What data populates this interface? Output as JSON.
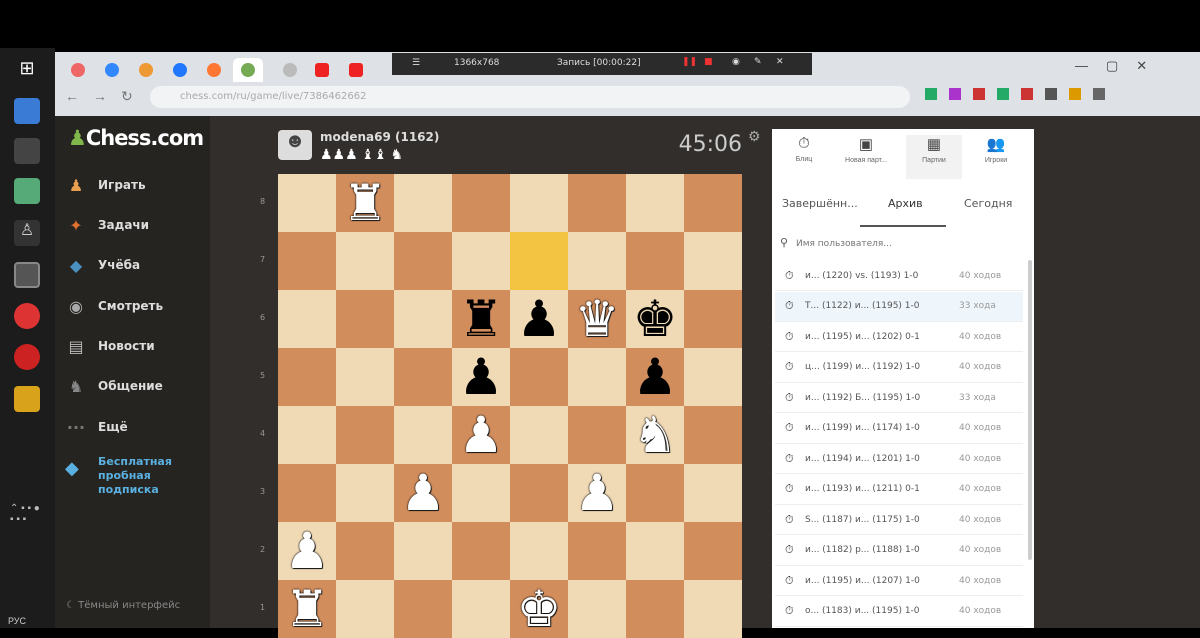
{
  "taskbar": {
    "lang": "РУС"
  },
  "recorder": {
    "size": "1366x768",
    "status": "Запись [00:00:22]"
  },
  "address": {
    "url": "chess.com/ru/game/live/7386462662"
  },
  "sidebar": {
    "logo": "Chess.com",
    "items": [
      {
        "label": "Играть",
        "icon": "pawn-icon"
      },
      {
        "label": "Задачи",
        "icon": "puzzle-icon"
      },
      {
        "label": "Учёба",
        "icon": "learn-icon"
      },
      {
        "label": "Смотреть",
        "icon": "watch-icon"
      },
      {
        "label": "Новости",
        "icon": "news-icon"
      },
      {
        "label": "Общение",
        "icon": "social-icon"
      },
      {
        "label": "Ещё",
        "icon": "more-icon"
      }
    ],
    "promo": "Бесплатная пробная подписка",
    "theme": "Тёмный интерфейс"
  },
  "game": {
    "opponent": "modena69 (1162)",
    "clock": "45:06",
    "board": [
      [
        "",
        "wR",
        "",
        "",
        "",
        "",
        "",
        ""
      ],
      [
        "",
        "",
        "",
        "",
        "",
        "",
        "",
        ""
      ],
      [
        "",
        "",
        "",
        "bR",
        "bP",
        "wQ",
        "bK",
        ""
      ],
      [
        "",
        "",
        "",
        "bP",
        "",
        "",
        "bP",
        ""
      ],
      [
        "",
        "",
        "",
        "wP",
        "",
        "",
        "wN",
        ""
      ],
      [
        "",
        "",
        "wP",
        "",
        "",
        "wP",
        "",
        ""
      ],
      [
        "wP",
        "",
        "",
        "",
        "",
        "",
        "",
        ""
      ],
      [
        "wR",
        "",
        "",
        "",
        "wK",
        "",
        "",
        ""
      ]
    ],
    "ranks": [
      "8",
      "7",
      "6",
      "5",
      "4",
      "3",
      "2",
      "1"
    ]
  },
  "panel": {
    "tabs": [
      "Блиц",
      "Новая парт...",
      "Партии",
      "Игроки"
    ],
    "subtabs": [
      "Завершённ...",
      "Архив",
      "Сегодня"
    ],
    "search_placeholder": "Имя пользователя...",
    "rows": [
      {
        "text": "и... (1220) vs. (1193) 1-0",
        "meta": "40 ходов"
      },
      {
        "text": "Т... (1122) и... (1195) 1-0",
        "meta": "33 хода"
      },
      {
        "text": "и... (1195) и... (1202) 0-1",
        "meta": "40 ходов"
      },
      {
        "text": "ц... (1199) и... (1192) 1-0",
        "meta": "40 ходов"
      },
      {
        "text": "и... (1192) Б... (1195) 1-0",
        "meta": "33 хода"
      },
      {
        "text": "и... (1199) и... (1174) 1-0",
        "meta": "40 ходов"
      },
      {
        "text": "и... (1194) и... (1201) 1-0",
        "meta": "40 ходов"
      },
      {
        "text": "и... (1193) и... (1211) 0-1",
        "meta": "40 ходов"
      },
      {
        "text": "S... (1187) и... (1175) 1-0",
        "meta": "40 ходов"
      },
      {
        "text": "и... (1182) р... (1188) 1-0",
        "meta": "40 ходов"
      },
      {
        "text": "и... (1195) и... (1207) 1-0",
        "meta": "40 ходов"
      },
      {
        "text": "о... (1183) и... (1195) 1-0",
        "meta": "40 ходов"
      }
    ]
  },
  "colors": {
    "light_square": "#f0d9b5",
    "dark_square": "#d28d5c",
    "highlight": "#f2c441",
    "page_bg": "#312e2b",
    "sidebar_bg": "#262421"
  }
}
